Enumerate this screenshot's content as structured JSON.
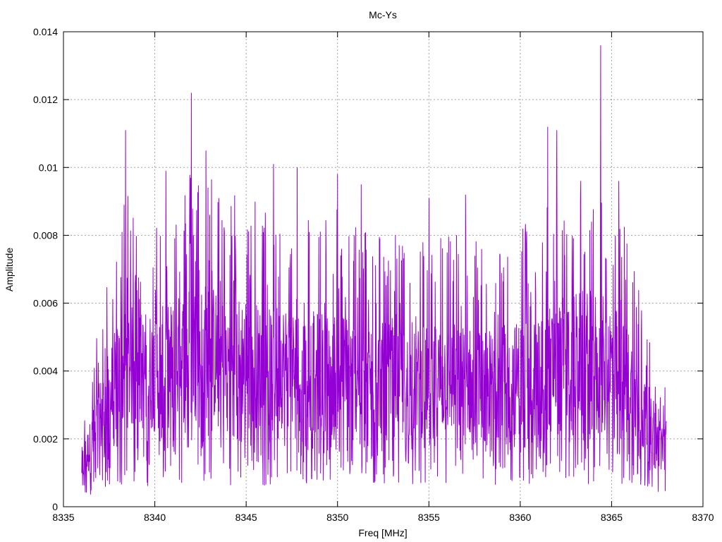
{
  "chart_data": {
    "type": "line",
    "title": "Mc-Ys",
    "xlabel": "Freq [MHz]",
    "ylabel": "Amplitude",
    "xlim": [
      8335,
      8370
    ],
    "ylim": [
      0,
      0.014
    ],
    "grid": true,
    "legend": "none",
    "x_ticks": [
      8335,
      8340,
      8345,
      8350,
      8355,
      8360,
      8365,
      8370
    ],
    "x_tick_labels": [
      "8335",
      "8340",
      "8345",
      "8350",
      "8355",
      "8360",
      "8365",
      "8370"
    ],
    "y_ticks": [
      0,
      0.002,
      0.004,
      0.006,
      0.008,
      0.01,
      0.012,
      0.014
    ],
    "y_tick_labels": [
      "0",
      "0.002",
      "0.004",
      "0.006",
      "0.008",
      "0.01",
      "0.012",
      "0.014"
    ],
    "series": [
      {
        "color": "#9400d3",
        "envelope": {
          "x": [
            8336.0,
            8336.5,
            8337.0,
            8337.5,
            8338.0,
            8338.5,
            8339.0,
            8340.0,
            8341.0,
            8342.0,
            8343.0,
            8344.0,
            8345.0,
            8346.0,
            8347.0,
            8348.0,
            8350.0,
            8352.0,
            8354.0,
            8356.0,
            8358.0,
            8360.0,
            8362.0,
            8363.0,
            8364.0,
            8365.0,
            8366.0,
            8366.5,
            8367.0,
            8367.5,
            8368.0
          ],
          "y": [
            0.0012,
            0.0018,
            0.0026,
            0.0032,
            0.0038,
            0.0042,
            0.004,
            0.004,
            0.0042,
            0.0046,
            0.0046,
            0.0042,
            0.0044,
            0.004,
            0.0042,
            0.004,
            0.004,
            0.0038,
            0.0036,
            0.0038,
            0.0036,
            0.0038,
            0.0042,
            0.0044,
            0.0044,
            0.0042,
            0.0036,
            0.003,
            0.0024,
            0.0018,
            0.0018
          ]
        },
        "peaks": [
          {
            "x": 8338.2,
            "y": 0.0081
          },
          {
            "x": 8338.4,
            "y": 0.0111
          },
          {
            "x": 8340.6,
            "y": 0.0099
          },
          {
            "x": 8342.0,
            "y": 0.0122
          },
          {
            "x": 8342.8,
            "y": 0.0105
          },
          {
            "x": 8346.5,
            "y": 0.0101
          },
          {
            "x": 8347.8,
            "y": 0.01
          },
          {
            "x": 8350.0,
            "y": 0.0098
          },
          {
            "x": 8351.3,
            "y": 0.0095
          },
          {
            "x": 8355.0,
            "y": 0.0091
          },
          {
            "x": 8357.0,
            "y": 0.0092
          },
          {
            "x": 8361.5,
            "y": 0.0112
          },
          {
            "x": 8362.0,
            "y": 0.0111
          },
          {
            "x": 8363.3,
            "y": 0.009
          },
          {
            "x": 8364.4,
            "y": 0.0136
          },
          {
            "x": 8365.4,
            "y": 0.0096
          }
        ]
      }
    ]
  }
}
